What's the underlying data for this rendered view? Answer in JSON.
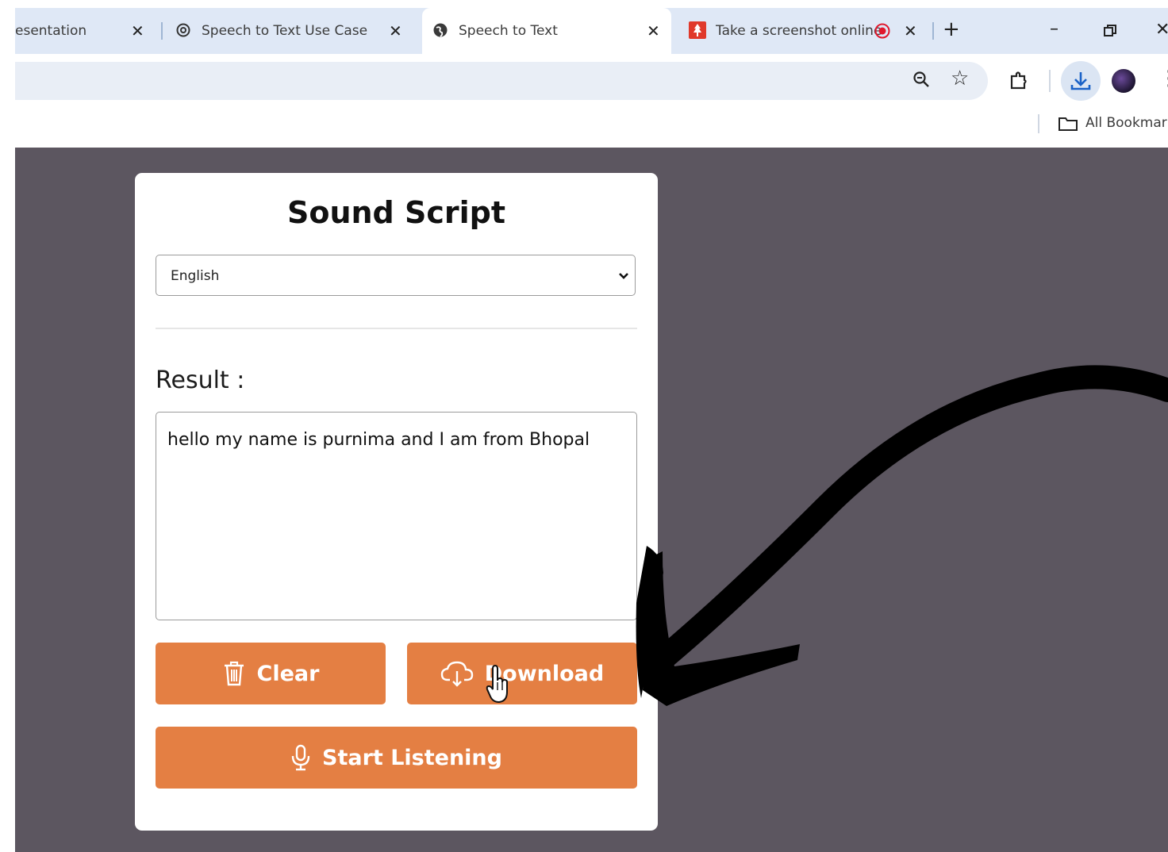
{
  "browser": {
    "tabs": [
      {
        "title": "esentation",
        "active": false
      },
      {
        "title": "Speech to Text Use Case",
        "active": false
      },
      {
        "title": "Speech to Text",
        "active": true
      },
      {
        "title": "Take a screenshot online",
        "active": false
      }
    ],
    "new_tab_label": "+",
    "bookmarks_label": "All Bookmark"
  },
  "app": {
    "title": "Sound Script",
    "language": {
      "selected": "English"
    },
    "result_label": "Result :",
    "result_text": "hello my name is purnima and I am from Bhopal",
    "buttons": {
      "clear": "Clear",
      "download": "Download",
      "start_listening": "Start Listening"
    }
  },
  "colors": {
    "accent": "#e47f43",
    "page_background": "#5c5660",
    "tabstrip": "#dfe8f6"
  }
}
